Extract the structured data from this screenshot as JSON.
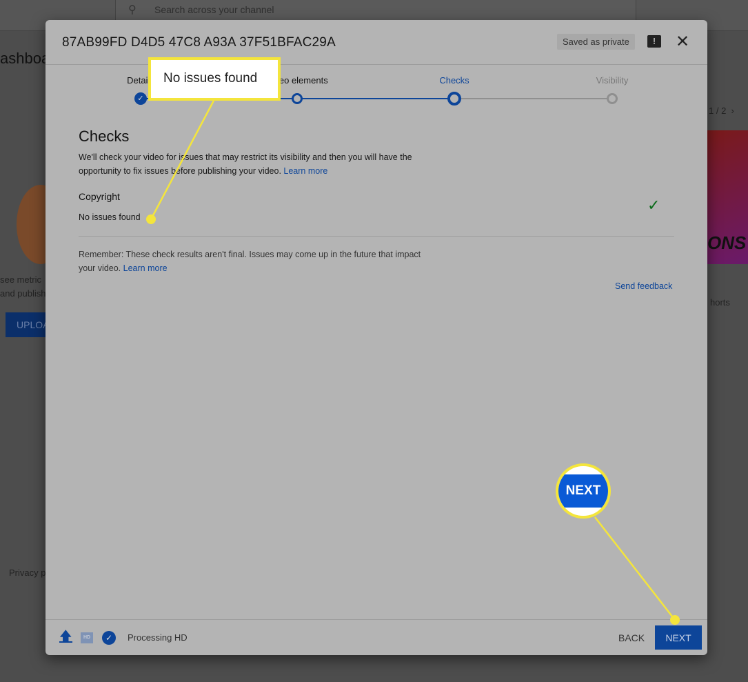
{
  "background": {
    "search_placeholder": "Search across your channel",
    "page_title_partial": "ashboa",
    "text_line1": "see metric",
    "text_line2": "and publish",
    "upload_partial": "UPLOA",
    "privacy_partial": "Privacy p",
    "pager": "1 / 2",
    "shorts_partial": "horts",
    "thumb_text": "ONS"
  },
  "dialog": {
    "title": "87AB99FD D4D5 47C8 A93A 37F51BFAC29A",
    "saved_badge": "Saved as private",
    "steps": [
      {
        "label": "Details",
        "state": "done"
      },
      {
        "label": "Video elements",
        "state": "done"
      },
      {
        "label": "Checks",
        "state": "current"
      },
      {
        "label": "Visibility",
        "state": "upcoming"
      }
    ],
    "heading": "Checks",
    "description": "We'll check your video for issues that may restrict its visibility and then you will have the opportunity to fix issues before publishing your video.",
    "learn_more": "Learn more",
    "copyright": {
      "title": "Copyright",
      "status": "No issues found"
    },
    "remember": "Remember: These check results aren't final. Issues may come up in the future that impact your video.",
    "remember_learn_more": "Learn more",
    "send_feedback": "Send feedback",
    "footer": {
      "hd_badge": "HD",
      "status": "Processing HD",
      "back": "BACK",
      "next": "NEXT"
    }
  },
  "annotations": {
    "callout_text": "No issues found",
    "next_zoom": "NEXT",
    "highlight_color": "#f4e53c"
  },
  "colors": {
    "accent": "#0d4599",
    "success": "#0b6b1a"
  }
}
